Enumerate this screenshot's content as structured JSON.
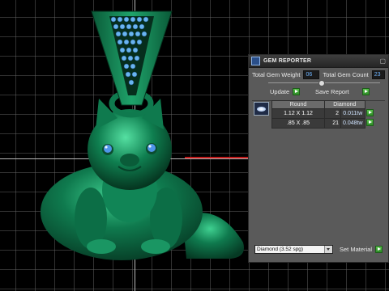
{
  "panel": {
    "title": "GEM REPORTER",
    "total_gem_weight_label": "Total Gem Weight",
    "total_gem_weight_value": "06",
    "total_gem_count_label": "Total Gem Count",
    "total_gem_count_value": "23",
    "update_label": "Update",
    "save_report_label": "Save Report",
    "table": {
      "headers": [
        "Round",
        "Diamond"
      ],
      "rows": [
        {
          "size": "1.12 X 1.12",
          "count": "2",
          "weight": "0.011tw"
        },
        {
          "size": ".85 X .85",
          "count": "21",
          "weight": "0.048tw"
        }
      ]
    },
    "material_select": "Diamond    (3.52 spg)",
    "set_material_label": "Set Material"
  },
  "colors": {
    "model_green": "#0f7a4e",
    "gem_blue": "#5aa8e8",
    "panel_bg": "#5a5a5a",
    "accent_green": "#3fae35"
  }
}
